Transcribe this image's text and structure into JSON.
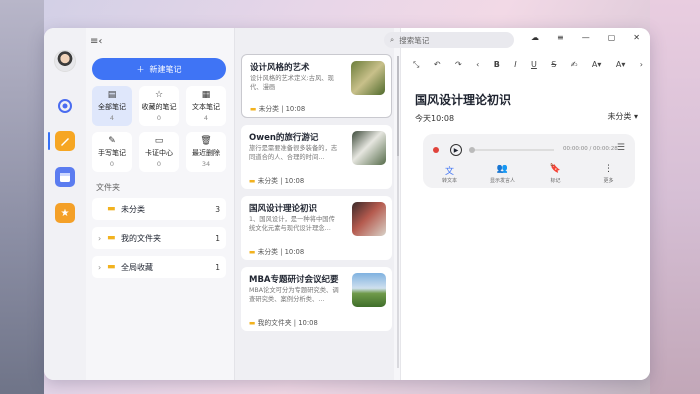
{
  "search": {
    "placeholder": "搜索笔记"
  },
  "left": {
    "new_note": "新建笔记",
    "tiles": [
      {
        "label": "全部笔记",
        "count": "4",
        "icon": "doc-icon"
      },
      {
        "label": "收藏的笔记",
        "count": "0",
        "icon": "star-icon"
      },
      {
        "label": "文本笔记",
        "count": "4",
        "icon": "text-icon"
      },
      {
        "label": "手写笔记",
        "count": "0",
        "icon": "pen-icon"
      },
      {
        "label": "卡证中心",
        "count": "0",
        "icon": "card-icon"
      },
      {
        "label": "最近删除",
        "count": "34",
        "icon": "trash-icon"
      }
    ],
    "folder_title": "文件夹",
    "folders": [
      {
        "name": "未分类",
        "count": "3"
      },
      {
        "name": "我的文件夹",
        "count": "1"
      },
      {
        "name": "全局收藏",
        "count": "1"
      }
    ]
  },
  "notes": [
    {
      "title": "设计风格的艺术",
      "body": "设计风格的艺术定义:古风、现代、漫画",
      "folder": "未分类",
      "time": "10:08"
    },
    {
      "title": "Owen的旅行游记",
      "body": "旅行是需要准备很多装备的，志同道合的人、合理的时间…",
      "folder": "未分类",
      "time": "10:08"
    },
    {
      "title": "国风设计理论初识",
      "body": "1、国风设计，是一种将中国传统文化元素与现代设计理念…",
      "folder": "未分类",
      "time": "10:08"
    },
    {
      "title": "MBA专题研讨会议纪要",
      "body": "MBA论文可分为专题研究类、调查研究类、案例分析类、…",
      "folder": "我的文件夹",
      "time": "10:08"
    }
  ],
  "editor": {
    "title": "国风设计理论初识",
    "date": "今天10:08",
    "category": "未分类",
    "time_display": "00:00:00 / 00:00:28",
    "actions": [
      {
        "label": "转文本",
        "icon": "transcribe-icon"
      },
      {
        "label": "显示发言人",
        "icon": "speaker-icon"
      },
      {
        "label": "标记",
        "icon": "bookmark-icon"
      },
      {
        "label": "更多",
        "icon": "more-icon"
      }
    ]
  }
}
